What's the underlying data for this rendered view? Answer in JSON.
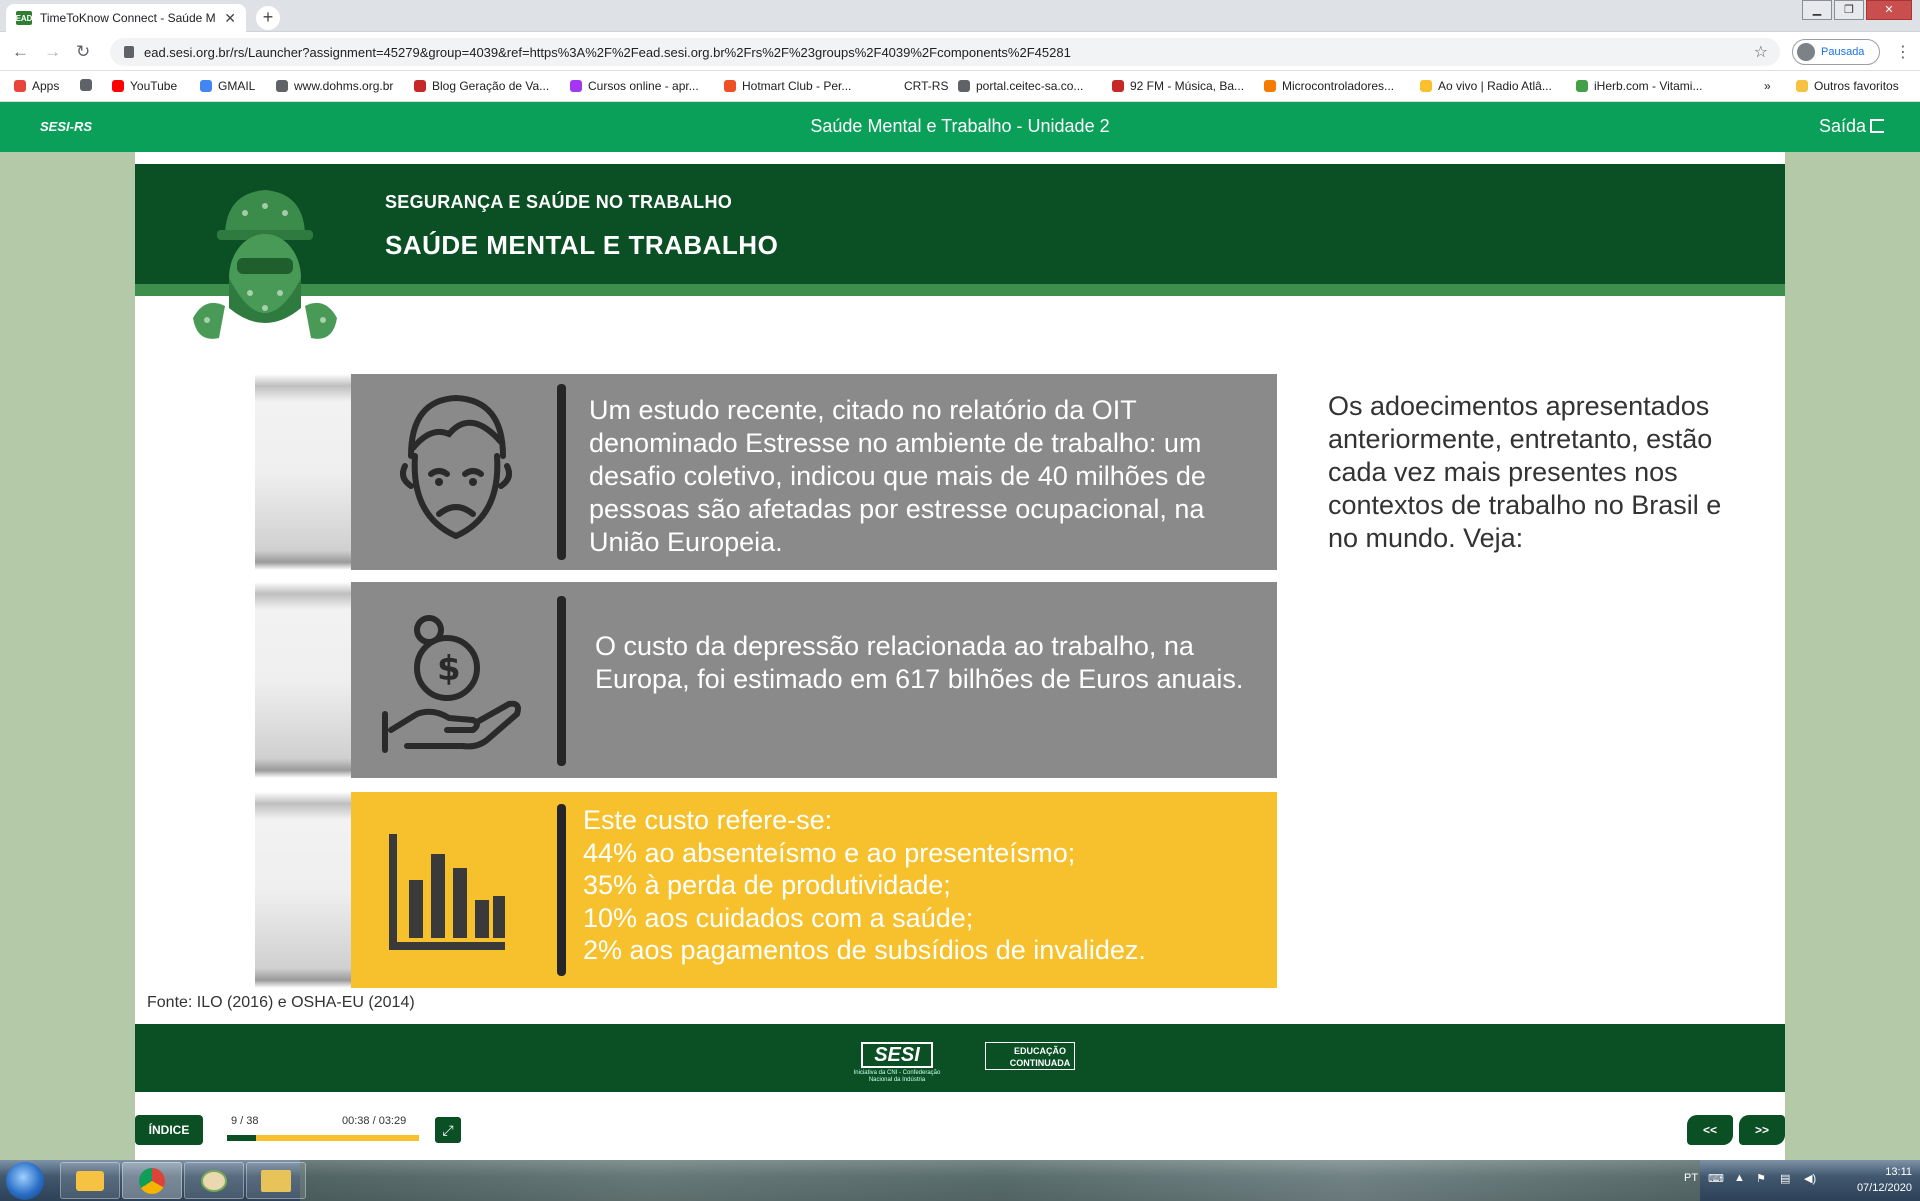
{
  "browser": {
    "tab_title": "TimeToKnow Connect - Saúde M",
    "tab_favicon": "EAD",
    "url": "ead.sesi.org.br/rs/Launcher?assignment=45279&group=4039&ref=https%3A%2F%2Fead.sesi.org.br%2Frs%2F%23groups%2F4039%2Fcomponents%2F45281",
    "profile_status": "Pausada",
    "bookmarks": [
      {
        "label": "Apps",
        "icon": "apps-grid-icon",
        "color": "#e8453c"
      },
      {
        "label": "",
        "icon": "globe-icon",
        "color": "#5f6368"
      },
      {
        "label": "YouTube",
        "icon": "youtube-icon",
        "color": "#ff0000"
      },
      {
        "label": "GMAIL",
        "icon": "google-icon",
        "color": "#4285f4"
      },
      {
        "label": "www.dohms.org.br",
        "icon": "globe-icon",
        "color": "#5f6368"
      },
      {
        "label": "Blog Geração de Va...",
        "icon": "blog-icon",
        "color": "#c62828"
      },
      {
        "label": "Cursos online - apr...",
        "icon": "udemy-icon",
        "color": "#a435f0"
      },
      {
        "label": "Hotmart Club - Per...",
        "icon": "hotmart-icon",
        "color": "#f04e23"
      },
      {
        "label": "CRT-RS",
        "icon": "blank-icon",
        "color": "#ffffff"
      },
      {
        "label": "portal.ceitec-sa.co...",
        "icon": "globe-icon",
        "color": "#5f6368"
      },
      {
        "label": "92 FM - Música, Ba...",
        "icon": "radio-92-icon",
        "color": "#c62828"
      },
      {
        "label": "Microcontroladores...",
        "icon": "blogger-icon",
        "color": "#f57c00"
      },
      {
        "label": "Ao vivo | Radio Atlâ...",
        "icon": "radio-icon",
        "color": "#fbc02d"
      },
      {
        "label": "iHerb.com - Vitami...",
        "icon": "iherb-icon",
        "color": "#43a047"
      },
      {
        "label": "»",
        "icon": "",
        "color": "#5f6368"
      },
      {
        "label": "Outros favoritos",
        "icon": "folder-icon",
        "color": "#f5c242"
      }
    ]
  },
  "app_header": {
    "brand": "SESI-RS",
    "title": "Saúde Mental e Trabalho - Unidade 2",
    "exit_label": "Saída"
  },
  "slide": {
    "supertitle": "SEGURANÇA E SAÚDE NO TRABALHO",
    "title": "SAÚDE MENTAL E TRABALHO",
    "cards": [
      {
        "icon": "sad-face-icon",
        "text": "Um estudo recente, citado no relatório da OIT denominado Estresse no ambiente de trabalho: um desafio coletivo, indicou que mais de 40 milhões de pessoas são afetadas por estresse ocupacional, na União Europeia."
      },
      {
        "icon": "hand-coins-icon",
        "text": "O custo da depressão relacionada ao trabalho, na Europa, foi estimado em 617 bilhões de Euros anuais."
      },
      {
        "icon": "bar-chart-icon",
        "lines": [
          "Este custo refere-se:",
          "44% ao absenteísmo e ao presenteísmo;",
          "35% à perda de produtividade;",
          "10% aos cuidados com a saúde;",
          "2% aos pagamentos de subsídios de invalidez."
        ]
      }
    ],
    "side_text": "Os adoecimentos apresentados anteriormente, entretanto, estão cada vez mais presentes nos contextos de trabalho no Brasil e no mundo. Veja:",
    "source": "Fonte: ILO (2016) e OSHA-EU (2014)",
    "footer": {
      "sesi_logo": "SESI",
      "sesi_tagline": "Iniciativa da CNI - Confederação Nacional da Indústria",
      "educ_logo": "EDUCAÇÃO CONTINUADA"
    }
  },
  "controls": {
    "index_label": "ÍNDICE",
    "page_counter": "9 / 38",
    "time_counter": "00:38 / 03:29",
    "progress_fraction": 0.15,
    "prev_label": "<<",
    "next_label": ">>"
  },
  "taskbar": {
    "language": "PT",
    "time": "13:11",
    "date": "07/12/2020"
  },
  "colors": {
    "app_header_green": "#0aa05a",
    "slide_dark_green": "#0b4f24",
    "card_gray": "#8a8a8a",
    "card_yellow": "#f6c12d",
    "side_panel_green": "#b4c9a7"
  }
}
